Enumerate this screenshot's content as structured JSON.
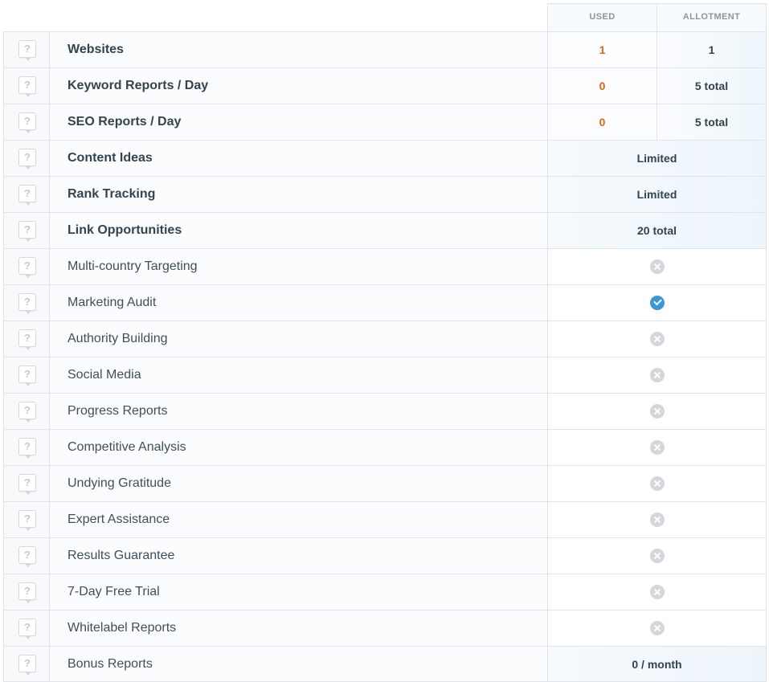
{
  "header": {
    "used_label": "USED",
    "allotment_label": "ALLOTMENT"
  },
  "rows": [
    {
      "label": "Websites",
      "bold": true,
      "used": "1",
      "allotment": "1"
    },
    {
      "label": "Keyword Reports / Day",
      "bold": true,
      "used": "0",
      "allotment": "5 total"
    },
    {
      "label": "SEO Reports / Day",
      "bold": true,
      "used": "0",
      "allotment": "5 total"
    },
    {
      "label": "Content Ideas",
      "bold": true,
      "value": "Limited"
    },
    {
      "label": "Rank Tracking",
      "bold": true,
      "value": "Limited"
    },
    {
      "label": "Link Opportunities",
      "bold": true,
      "value": "20 total"
    },
    {
      "label": "Multi-country Targeting",
      "bold": false,
      "status": "unavailable"
    },
    {
      "label": "Marketing Audit",
      "bold": false,
      "status": "available"
    },
    {
      "label": "Authority Building",
      "bold": false,
      "status": "unavailable"
    },
    {
      "label": "Social Media",
      "bold": false,
      "status": "unavailable"
    },
    {
      "label": "Progress Reports",
      "bold": false,
      "status": "unavailable"
    },
    {
      "label": "Competitive Analysis",
      "bold": false,
      "status": "unavailable"
    },
    {
      "label": "Undying Gratitude",
      "bold": false,
      "status": "unavailable"
    },
    {
      "label": "Expert Assistance",
      "bold": false,
      "status": "unavailable"
    },
    {
      "label": "Results Guarantee",
      "bold": false,
      "status": "unavailable"
    },
    {
      "label": "7-Day Free Trial",
      "bold": false,
      "status": "unavailable"
    },
    {
      "label": "Whitelabel Reports",
      "bold": false,
      "status": "unavailable"
    },
    {
      "label": "Bonus Reports",
      "bold": false,
      "value": "0 / month"
    }
  ],
  "help_icon_glyph": "?",
  "colors": {
    "used_value": "#e0660f",
    "check": "#3d97d6",
    "cross": "#d4d8dc"
  }
}
